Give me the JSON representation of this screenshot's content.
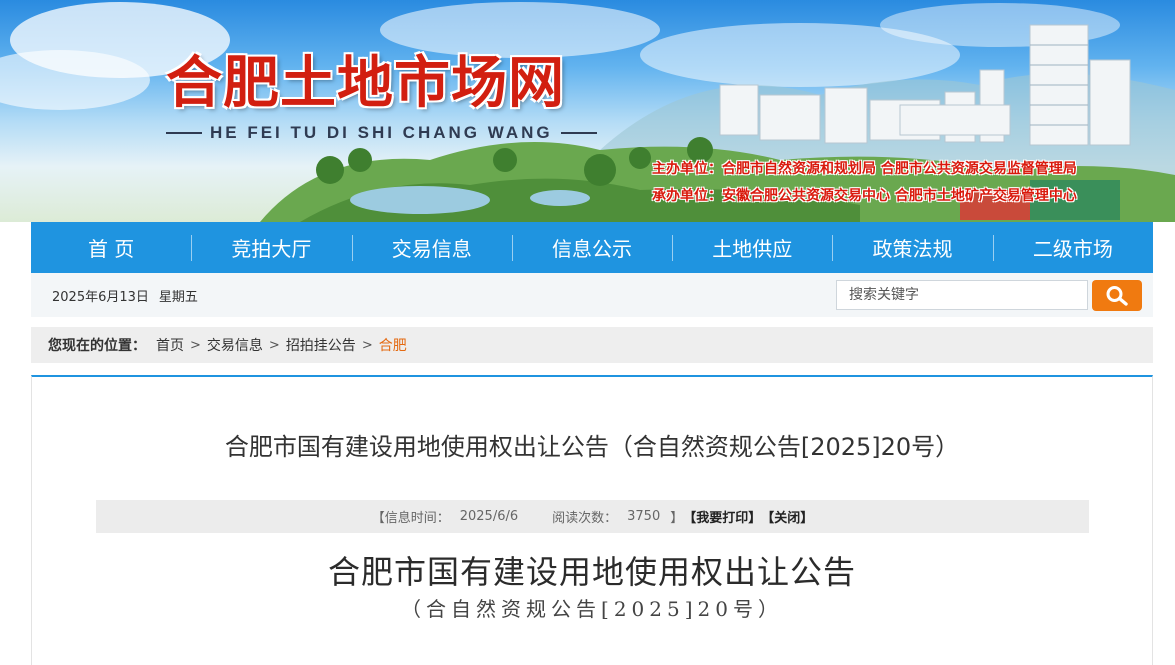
{
  "header": {
    "site_title": "合肥土地市场网",
    "site_pinyin": "HE FEI TU DI SHI CHANG WANG",
    "host_line": "主办单位：合肥市自然资源和规划局  合肥市公共资源交易监督管理局",
    "organizer_line": "承办单位：安徽合肥公共资源交易中心  合肥市土地矿产交易管理中心"
  },
  "nav": {
    "items": [
      {
        "label": "首 页"
      },
      {
        "label": "竞拍大厅"
      },
      {
        "label": "交易信息"
      },
      {
        "label": "信息公示"
      },
      {
        "label": "土地供应"
      },
      {
        "label": "政策法规"
      },
      {
        "label": "二级市场"
      }
    ]
  },
  "info_bar": {
    "date": "2025年6月13日",
    "weekday": "星期五",
    "search_placeholder": "搜索关键字"
  },
  "breadcrumb": {
    "label": "您现在的位置：",
    "items": [
      "首页",
      "交易信息",
      "招拍挂公告"
    ],
    "current": "合肥"
  },
  "article": {
    "title": "合肥市国有建设用地使用权出让公告（合自然资规公告[2025]20号）",
    "meta": {
      "open": "【信息时间：",
      "date": "2025/6/6",
      "views_label": "阅读次数：",
      "views": "3750",
      "close": "】",
      "print_label": "【我要打印】",
      "close_label": "【关闭】"
    },
    "doc_title": "合肥市国有建设用地使用权出让公告",
    "doc_subtitle": "（合自然资规公告[2025]20号）"
  },
  "colors": {
    "nav_bg": "#1f94e0",
    "title_red": "#d21f10",
    "search_button": "#f07a10",
    "breadcrumb_current": "#e46a12"
  },
  "icons": {
    "search": "magnifier-icon"
  }
}
